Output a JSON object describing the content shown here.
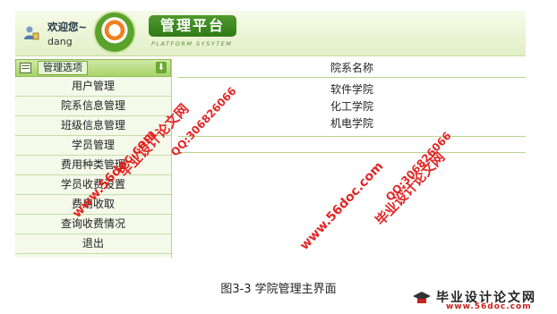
{
  "header": {
    "welcome": "欢迎您~",
    "username": "dang",
    "logo_title": "管理平台",
    "logo_subtitle": "PLATFORM SYSYTEM"
  },
  "sidebar": {
    "title": "管理选项",
    "items": [
      {
        "label": "用户管理"
      },
      {
        "label": "院系信息管理"
      },
      {
        "label": "班级信息管理"
      },
      {
        "label": "学员管理"
      },
      {
        "label": "费用种类管理"
      },
      {
        "label": "学员收费设置"
      },
      {
        "label": "费用收取"
      },
      {
        "label": "查询收费情况"
      },
      {
        "label": "退出"
      }
    ]
  },
  "table": {
    "header": "院系名称",
    "rows": [
      "软件学院",
      "化工学院",
      "机电学院"
    ]
  },
  "caption": "图3-3 学院管理主界面",
  "footer": {
    "title": "毕业设计论文网",
    "url": "www.56doc.com"
  },
  "watermarks": {
    "site_cn": "毕业设计论文网",
    "qq": "QQ:306826066",
    "url": "www.56doc.com"
  },
  "colors": {
    "accent_green": "#5aa22a",
    "watermark_red": "#e21b1b"
  }
}
